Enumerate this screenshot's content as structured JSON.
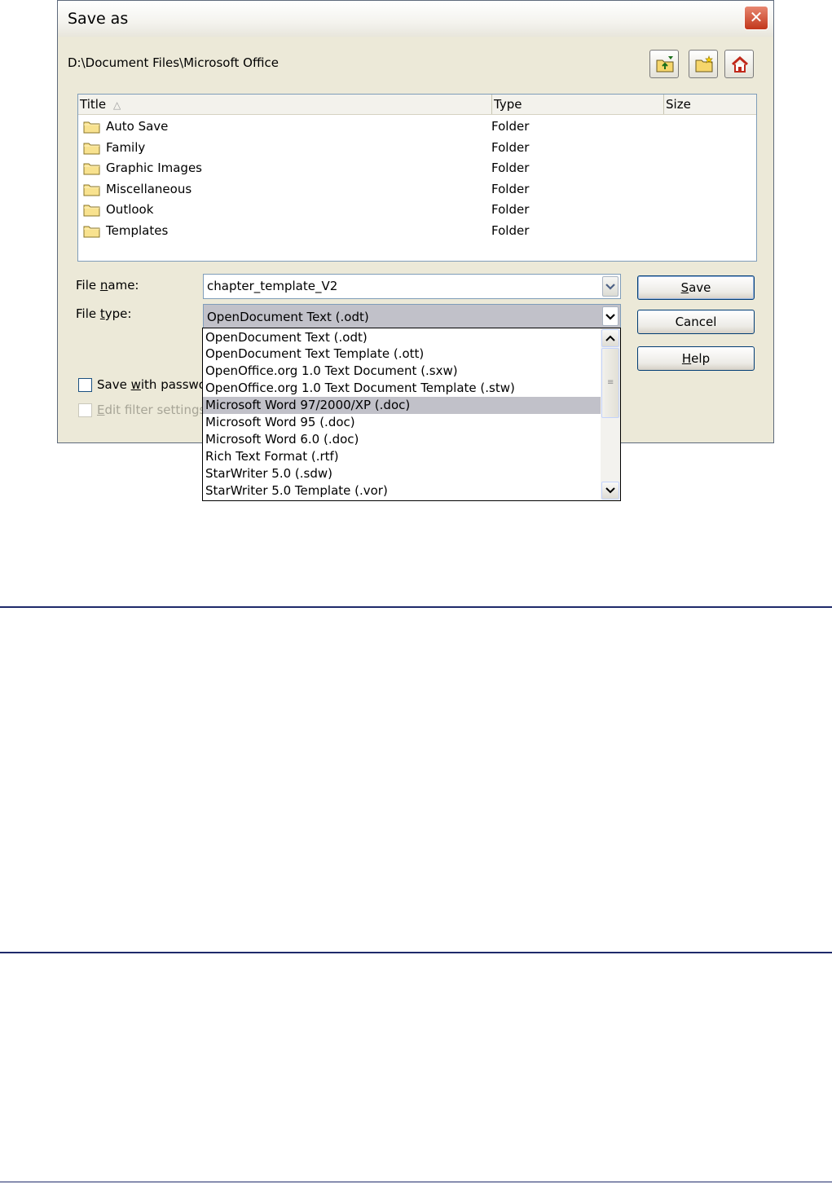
{
  "window": {
    "title": "Save as",
    "close_symbol": "✕"
  },
  "path": "D:\\Document Files\\Microsoft Office",
  "toolbar": {
    "up_icon": "folder-up-icon",
    "new_folder_icon": "new-folder-icon",
    "home_icon": "home-icon"
  },
  "file_list": {
    "columns": [
      "Title",
      "Type",
      "Size"
    ],
    "sort_indicator": "△",
    "rows": [
      {
        "name": "Auto Save",
        "type": "Folder"
      },
      {
        "name": "Family",
        "type": "Folder"
      },
      {
        "name": "Graphic Images",
        "type": "Folder"
      },
      {
        "name": "Miscellaneous",
        "type": "Folder"
      },
      {
        "name": "Outlook",
        "type": "Folder"
      },
      {
        "name": "Templates",
        "type": "Folder"
      }
    ]
  },
  "form": {
    "file_name_label": "File name:",
    "file_name_value": "chapter_template_V2",
    "file_type_label": "File type:",
    "file_type_value": "OpenDocument Text (.odt)",
    "save_password_label": "Save with passwo",
    "edit_filter_label": "Edit filter settings"
  },
  "buttons": {
    "save": "Save",
    "cancel": "Cancel",
    "help": "Help"
  },
  "dropdown": {
    "selected_index": 4,
    "options": [
      "OpenDocument Text (.odt)",
      "OpenDocument Text Template (.ott)",
      "OpenOffice.org 1.0 Text Document (.sxw)",
      "OpenOffice.org 1.0 Text Document Template (.stw)",
      "Microsoft Word 97/2000/XP (.doc)",
      "Microsoft Word 95 (.doc)",
      "Microsoft Word 6.0 (.doc)",
      "Rich Text Format (.rtf)",
      "StarWriter 5.0 (.sdw)",
      "StarWriter 5.0 Template (.vor)"
    ]
  },
  "colors": {
    "dialog_bg": "#ece9d8",
    "selection": "#c1c1c9",
    "close": "#c2371b",
    "rule": "#1e2a6a"
  }
}
